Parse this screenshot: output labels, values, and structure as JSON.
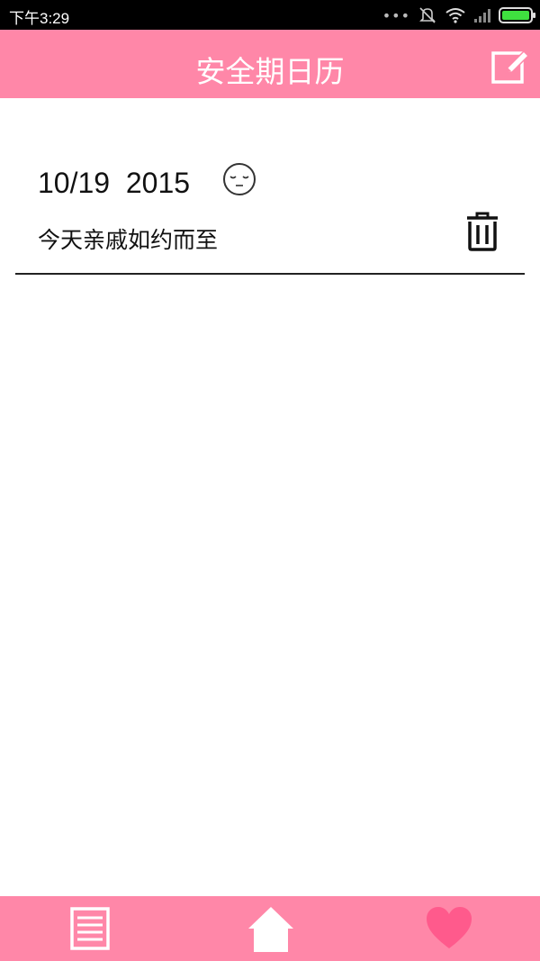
{
  "status_bar": {
    "time": "下午3:29",
    "battery_level": 1.0,
    "battery_color": "#3fe03f"
  },
  "header": {
    "title": "安全期日历",
    "background": "#ff87a8",
    "edit_icon": "edit-icon"
  },
  "entries": [
    {
      "date": "10/19  2015",
      "mood_icon": "sleepy-face-icon",
      "note": "今天亲戚如约而至",
      "delete_icon": "trash-icon"
    }
  ],
  "bottom_nav": {
    "items": [
      {
        "icon": "list-icon"
      },
      {
        "icon": "home-icon"
      },
      {
        "icon": "heart-icon",
        "color": "#ff5a8c"
      }
    ]
  }
}
